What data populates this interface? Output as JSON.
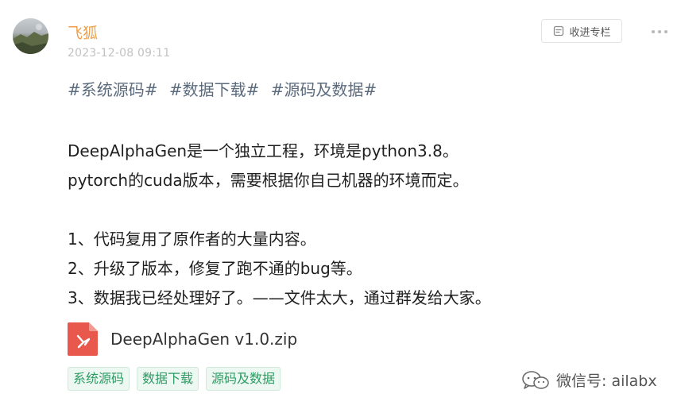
{
  "post": {
    "author": "飞狐",
    "timestamp": "2023-12-08 09:11",
    "collect_label": "收进专栏",
    "hashtags": [
      "#系统源码#",
      "#数据下载#",
      "#源码及数据#"
    ],
    "content_lines": [
      "DeepAlphaGen是一个独立工程，环境是python3.8。",
      "pytorch的cuda版本，需要根据你自己机器的环境而定。",
      "",
      "1、代码复用了原作者的大量内容。",
      "2、升级了版本，修复了跑不通的bug等。",
      "3、数据我已经处理好了。——文件太大，通过群发给大家。"
    ],
    "attachment": {
      "file_name": "DeepAlphaGen v1.0.zip",
      "icon": "pdf-file-icon",
      "icon_color": "#e8584c"
    },
    "tags": [
      "系统源码",
      "数据下载",
      "源码及数据"
    ]
  },
  "watermark": {
    "text": "微信号: ailabx",
    "icon": "wechat-icon"
  },
  "colors": {
    "author": "#f0a04b",
    "hashtag": "#5b6b7d",
    "tag_text": "#2d9b63",
    "tag_bg": "#eef8f2"
  }
}
